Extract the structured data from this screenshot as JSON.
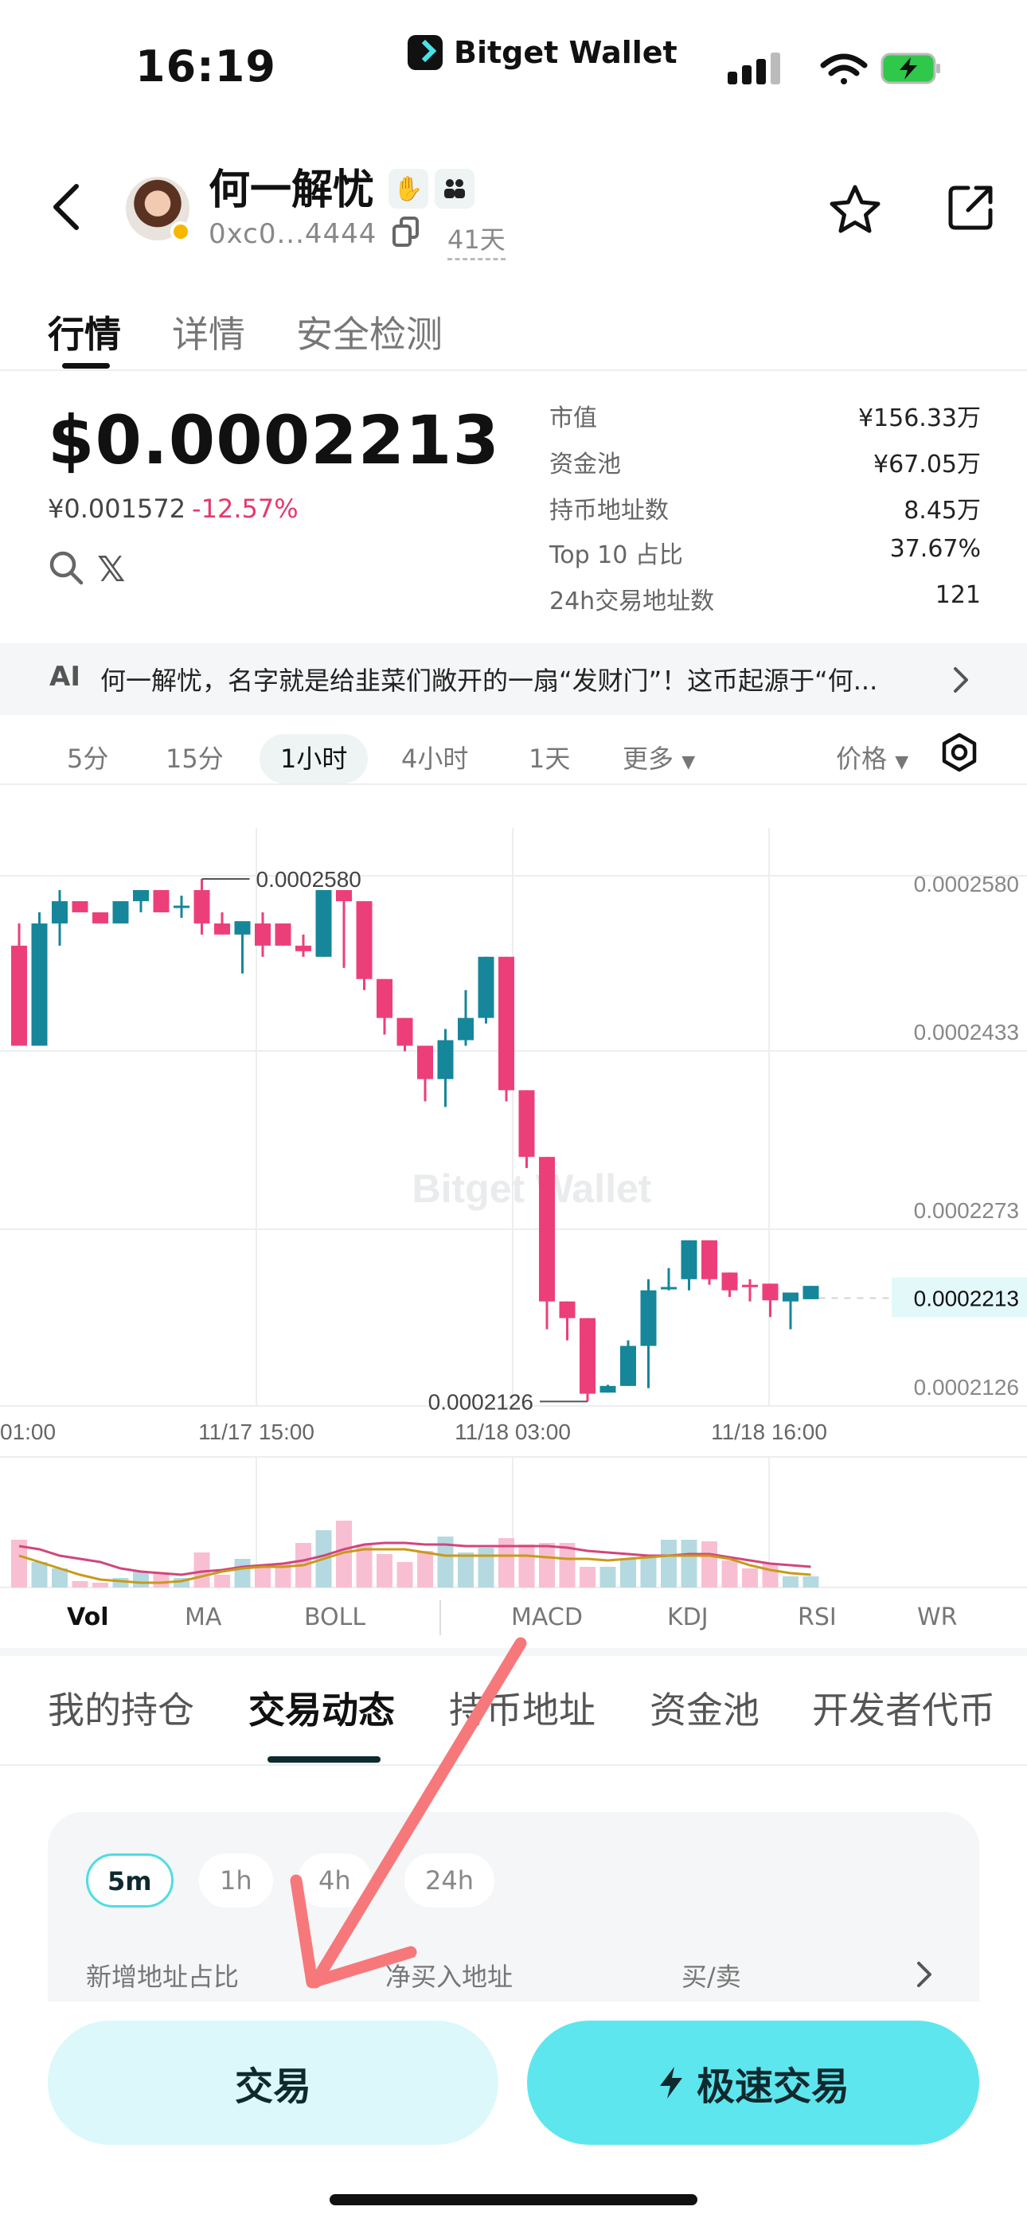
{
  "status_bar": {
    "time": "16:19",
    "app_name": "Bitget Wallet"
  },
  "token": {
    "name": "何一解忧",
    "address": "0xc0...4444",
    "age": "41天"
  },
  "main_tabs": [
    {
      "label": "行情"
    },
    {
      "label": "详情"
    },
    {
      "label": "安全检测"
    }
  ],
  "price": {
    "usd": "$0.0002213",
    "cny": "¥0.001572",
    "change": "-12.57%"
  },
  "stats": [
    {
      "label": "市值",
      "value": "¥156.33万"
    },
    {
      "label": "资金池",
      "value": "¥67.05万"
    },
    {
      "label": "持币地址数",
      "value": "8.45万"
    },
    {
      "label": "Top 10 占比",
      "value": "37.67%"
    },
    {
      "label": "24h交易地址数",
      "value": "121"
    }
  ],
  "ai_banner": {
    "label": "AI",
    "text": "何一解忧，名字就是给韭菜们敞开的一扇“发财门”！这币起源于“何..."
  },
  "intervals": [
    {
      "label": "5分"
    },
    {
      "label": "15分"
    },
    {
      "label": "1小时"
    },
    {
      "label": "4小时"
    },
    {
      "label": "1天"
    }
  ],
  "interval_more": "更多",
  "price_mode": "价格",
  "chart_data": {
    "type": "candlestick",
    "interval": "1小时",
    "watermark": "Bitget Wallet",
    "y_ticks": [
      "0.0002580",
      "0.0002433",
      "0.0002273",
      "0.0002126"
    ],
    "y_range": [
      0.0002126,
      0.000258
    ],
    "x_ticks": [
      "01:00",
      "11/17 15:00",
      "11/18 03:00",
      "11/18 16:00"
    ],
    "high_label": "0.0002580",
    "low_label": "0.0002126",
    "current_price": "0.0002213",
    "up_color": "#16869a",
    "down_color": "#ec3f7a",
    "candles": [
      {
        "o": 0.000253,
        "h": 0.000255,
        "l": 0.000244,
        "c": 0.000244
      },
      {
        "o": 0.000244,
        "h": 0.000256,
        "l": 0.000244,
        "c": 0.000255
      },
      {
        "o": 0.000255,
        "h": 0.000258,
        "l": 0.000253,
        "c": 0.000257
      },
      {
        "o": 0.000257,
        "h": 0.000257,
        "l": 0.000256,
        "c": 0.000256
      },
      {
        "o": 0.000256,
        "h": 0.000256,
        "l": 0.000255,
        "c": 0.000255
      },
      {
        "o": 0.000255,
        "h": 0.000257,
        "l": 0.000255,
        "c": 0.000257
      },
      {
        "o": 0.000257,
        "h": 0.000258,
        "l": 0.000256,
        "c": 0.000258
      },
      {
        "o": 0.000258,
        "h": 0.000258,
        "l": 0.000256,
        "c": 0.000256
      },
      {
        "o": 0.0002564,
        "h": 0.0002575,
        "l": 0.0002555,
        "c": 0.0002566
      },
      {
        "o": 0.000258,
        "h": 0.000259,
        "l": 0.000254,
        "c": 0.000255
      },
      {
        "o": 0.000255,
        "h": 0.000256,
        "l": 0.000254,
        "c": 0.000254
      },
      {
        "o": 0.000254,
        "h": 0.000255,
        "l": 0.0002505,
        "c": 0.0002552
      },
      {
        "o": 0.000255,
        "h": 0.000256,
        "l": 0.000252,
        "c": 0.000253
      },
      {
        "o": 0.000255,
        "h": 0.000255,
        "l": 0.000253,
        "c": 0.000253
      },
      {
        "o": 0.000253,
        "h": 0.000254,
        "l": 0.000252,
        "c": 0.0002525
      },
      {
        "o": 0.000252,
        "h": 0.000258,
        "l": 0.000252,
        "c": 0.000258
      },
      {
        "o": 0.000258,
        "h": 0.000258,
        "l": 0.000251,
        "c": 0.000257
      },
      {
        "o": 0.000257,
        "h": 0.000257,
        "l": 0.000249,
        "c": 0.00025
      },
      {
        "o": 0.00025,
        "h": 0.00025,
        "l": 0.000245,
        "c": 0.0002465
      },
      {
        "o": 0.0002465,
        "h": 0.0002465,
        "l": 0.0002435,
        "c": 0.000244
      },
      {
        "o": 0.000244,
        "h": 0.000244,
        "l": 0.000239,
        "c": 0.000241
      },
      {
        "o": 0.000241,
        "h": 0.0002455,
        "l": 0.0002385,
        "c": 0.0002445
      },
      {
        "o": 0.0002445,
        "h": 0.000249,
        "l": 0.000244,
        "c": 0.0002465
      },
      {
        "o": 0.0002465,
        "h": 0.000252,
        "l": 0.000246,
        "c": 0.000252
      },
      {
        "o": 0.000252,
        "h": 0.000252,
        "l": 0.000239,
        "c": 0.00024
      },
      {
        "o": 0.00024,
        "h": 0.00024,
        "l": 0.000233,
        "c": 0.000234
      },
      {
        "o": 0.000234,
        "h": 0.000234,
        "l": 0.0002185,
        "c": 0.000221
      },
      {
        "o": 0.000221,
        "h": 0.000221,
        "l": 0.0002175,
        "c": 0.0002195
      },
      {
        "o": 0.0002195,
        "h": 0.0002195,
        "l": 0.000212,
        "c": 0.0002127
      },
      {
        "o": 0.0002128,
        "h": 0.0002135,
        "l": 0.0002128,
        "c": 0.0002134
      },
      {
        "o": 0.0002134,
        "h": 0.0002175,
        "l": 0.0002134,
        "c": 0.000217
      },
      {
        "o": 0.000217,
        "h": 0.000223,
        "l": 0.0002132,
        "c": 0.000222
      },
      {
        "o": 0.0002221,
        "h": 0.000224,
        "l": 0.000222,
        "c": 0.0002223
      },
      {
        "o": 0.000223,
        "h": 0.0002265,
        "l": 0.000222,
        "c": 0.0002265
      },
      {
        "o": 0.0002265,
        "h": 0.0002265,
        "l": 0.0002225,
        "c": 0.000223
      },
      {
        "o": 0.0002236,
        "h": 0.0002236,
        "l": 0.0002214,
        "c": 0.000222
      },
      {
        "o": 0.0002225,
        "h": 0.000223,
        "l": 0.000221,
        "c": 0.0002224
      },
      {
        "o": 0.0002226,
        "h": 0.0002226,
        "l": 0.0002196,
        "c": 0.0002211
      },
      {
        "o": 0.000221,
        "h": 0.0002218,
        "l": 0.0002185,
        "c": 0.0002218
      },
      {
        "o": 0.0002212,
        "h": 0.0002224,
        "l": 0.0002212,
        "c": 0.0002224
      }
    ],
    "volume": [
      30,
      16,
      12,
      4,
      3,
      6,
      10,
      9,
      6,
      22,
      8,
      18,
      13,
      15,
      28,
      36,
      42,
      27,
      21,
      16,
      23,
      32,
      22,
      25,
      31,
      27,
      28,
      28,
      13,
      13,
      18,
      20,
      30,
      30,
      29,
      17,
      12,
      15,
      7,
      7
    ],
    "ma_line": [
      26,
      24,
      20,
      18,
      16,
      12,
      10,
      9,
      8,
      10,
      11,
      13,
      14,
      15,
      17,
      20,
      24,
      27,
      28,
      28,
      27,
      27,
      26,
      26,
      26,
      26,
      26,
      25,
      23,
      22,
      21,
      20,
      20,
      21,
      21,
      19,
      17,
      15,
      14,
      13
    ],
    "ma_line2": [
      20,
      16,
      12,
      8,
      5,
      4,
      3,
      3,
      4,
      7,
      10,
      12,
      13,
      13,
      14,
      18,
      22,
      24,
      24,
      24,
      22,
      20,
      20,
      20,
      20,
      20,
      19,
      18,
      18,
      17,
      18,
      19,
      20,
      20,
      20,
      18,
      14,
      11,
      9,
      8
    ]
  },
  "indicator_tabs": [
    {
      "label": "Vol"
    },
    {
      "label": "MA"
    },
    {
      "label": "BOLL"
    },
    {
      "label": "MACD"
    },
    {
      "label": "KDJ"
    },
    {
      "label": "RSI"
    },
    {
      "label": "WR"
    }
  ],
  "bottom_tabs": [
    {
      "label": "我的持仓"
    },
    {
      "label": "交易动态"
    },
    {
      "label": "持币地址"
    },
    {
      "label": "资金池"
    },
    {
      "label": "开发者代币"
    }
  ],
  "activity": {
    "ranges": [
      {
        "label": "5m"
      },
      {
        "label": "1h"
      },
      {
        "label": "4h"
      },
      {
        "label": "24h"
      }
    ],
    "columns": [
      {
        "label": "新增地址占比"
      },
      {
        "label": "净买入地址"
      },
      {
        "label": "买/卖"
      }
    ]
  },
  "buttons": {
    "trade": "交易",
    "fast_trade": "极速交易"
  },
  "colors": {
    "accent": "#5ee6ee",
    "down": "#ec3f7a",
    "up": "#16869a",
    "annotation_arrow": "#f7787a"
  }
}
